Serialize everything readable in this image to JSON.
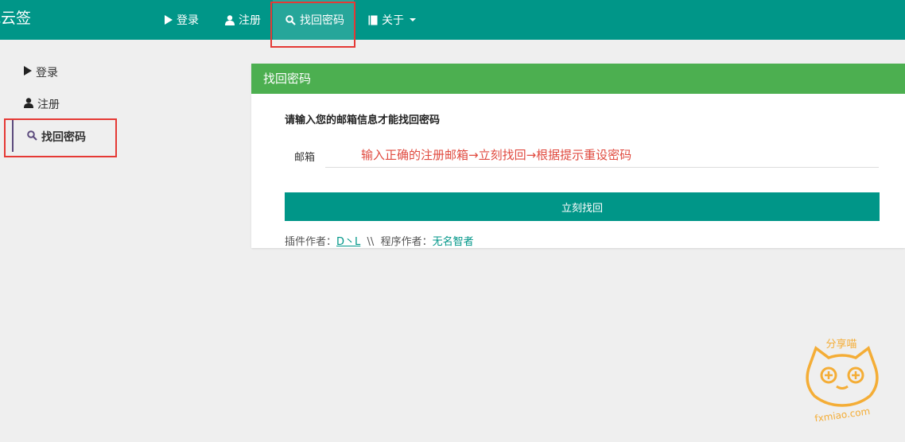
{
  "app": {
    "brand": "吧云签"
  },
  "navbar": {
    "items": [
      {
        "label": "登录",
        "icon": "play-icon"
      },
      {
        "label": "注册",
        "icon": "user-icon"
      },
      {
        "label": "找回密码",
        "icon": "search-icon",
        "active": true
      },
      {
        "label": "关于",
        "icon": "book-icon",
        "dropdown": true
      }
    ]
  },
  "sidebar": {
    "items": [
      {
        "label": "登录",
        "icon": "play-icon"
      },
      {
        "label": "注册",
        "icon": "user-icon"
      },
      {
        "label": "找回密码",
        "icon": "search-icon",
        "active": true
      }
    ]
  },
  "panel": {
    "title": "找回密码",
    "description": "请输入您的邮箱信息才能找回密码",
    "email_label": "邮箱",
    "email_placeholder": "输入正确的注册邮箱→立刻找回→根据提示重设密码",
    "submit_label": "立刻找回",
    "credits": {
      "plugin_author_label": "插件作者：",
      "plugin_author": "D丶L",
      "separator": "\\\\",
      "program_author_label": "程序作者：",
      "program_author": "无名智者"
    }
  },
  "watermark": {
    "text": "分享喵",
    "domain": "fxmiao.com"
  },
  "colors": {
    "navbar": "#009688",
    "panel_heading": "#4caf50",
    "button": "#009688",
    "highlight": "#e53935",
    "hint_text": "#e04a3f",
    "watermark": "#f5a623"
  }
}
